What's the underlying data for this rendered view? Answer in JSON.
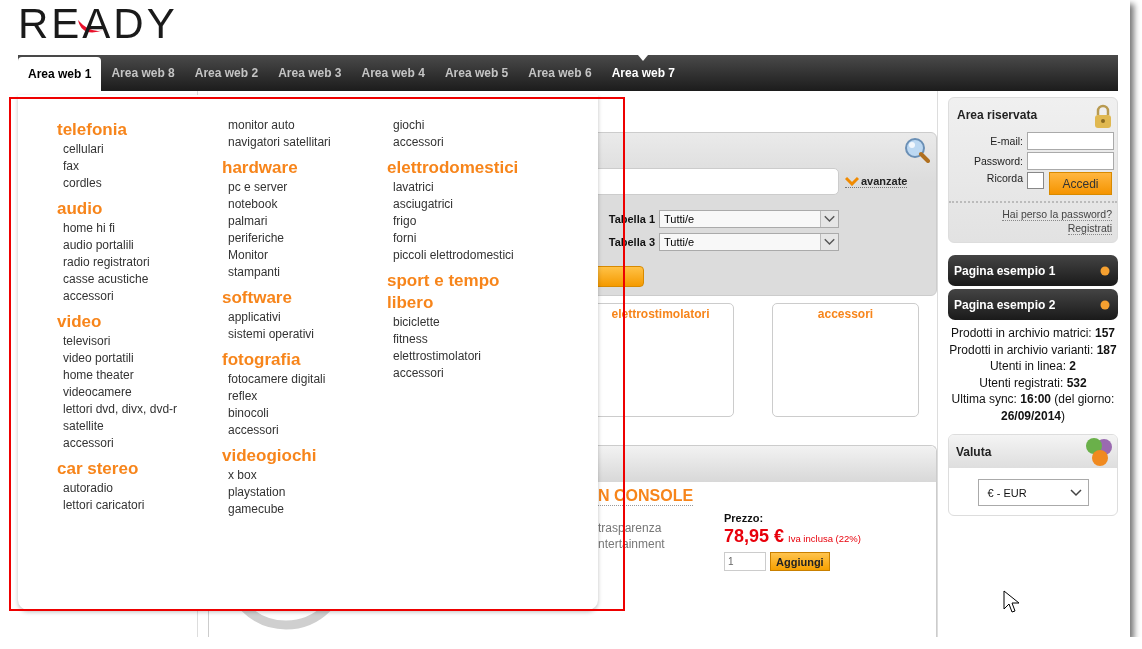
{
  "logo": {
    "text": "READY"
  },
  "nav": {
    "tabs": [
      {
        "label": "Area web 1",
        "selected": true,
        "hovered": false
      },
      {
        "label": "Area web 8",
        "selected": false,
        "hovered": false
      },
      {
        "label": "Area web 2",
        "selected": false,
        "hovered": false
      },
      {
        "label": "Area web 3",
        "selected": false,
        "hovered": false
      },
      {
        "label": "Area web 4",
        "selected": false,
        "hovered": false
      },
      {
        "label": "Area web 5",
        "selected": false,
        "hovered": false
      },
      {
        "label": "Area web 6",
        "selected": false,
        "hovered": false
      },
      {
        "label": "Area web 7",
        "selected": false,
        "hovered": true
      }
    ]
  },
  "menu": {
    "columns": [
      {
        "groups": [
          {
            "heading": "telefonia",
            "items": [
              "cellulari",
              "fax",
              "cordles"
            ]
          },
          {
            "heading": "audio",
            "items": [
              "home hi fi",
              "audio portalili",
              "radio registratori",
              "casse acustiche",
              "accessori"
            ]
          },
          {
            "heading": "video",
            "items": [
              "televisori",
              "video portatili",
              "home theater",
              "videocamere",
              "lettori dvd, divx, dvd-r",
              "satellite",
              "accessori"
            ]
          },
          {
            "heading": "car stereo",
            "items": [
              "autoradio",
              "lettori caricatori"
            ]
          }
        ]
      },
      {
        "groups": [
          {
            "items": [
              "monitor auto",
              "navigatori satellitari"
            ]
          },
          {
            "heading": "hardware",
            "items": [
              "pc e server",
              "notebook",
              "palmari",
              "periferiche",
              "Monitor",
              "stampanti"
            ]
          },
          {
            "heading": "software",
            "items": [
              "applicativi",
              "sistemi operativi"
            ]
          },
          {
            "heading": "fotografia",
            "items": [
              "fotocamere digitali",
              "reflex",
              "binocoli",
              "accessori"
            ]
          },
          {
            "heading": "videogiochi",
            "items": [
              "x box",
              "playstation",
              "gamecube"
            ]
          }
        ]
      },
      {
        "groups": [
          {
            "items": [
              "giochi",
              "accessori"
            ]
          },
          {
            "heading": "elettrodomestici",
            "items": [
              "lavatrici",
              "asciugatrici",
              "frigo",
              "forni",
              "piccoli elettrodomestici"
            ]
          },
          {
            "heading": "sport e tempo libero",
            "items": [
              "biciclette",
              "fitness",
              "elettrostimolatori",
              "accessori"
            ]
          }
        ]
      }
    ]
  },
  "search": {
    "advanced_link": "avanzate",
    "filters": [
      {
        "label": "Tabella 1",
        "value": "Tutti/e"
      },
      {
        "label": "Tabella 3",
        "value": "Tutti/e"
      }
    ]
  },
  "categories": [
    {
      "title": "elettrostimolatori"
    },
    {
      "title": "accessori"
    }
  ],
  "product": {
    "title": "N CONSOLE",
    "description_lines": [
      "trasparenza",
      "ntertainment"
    ],
    "price_label": "Prezzo:",
    "price": "78,95 €",
    "tax_note": "Iva inclusa (22%)",
    "quantity": "1",
    "add_button": "Aggiungi"
  },
  "login": {
    "title": "Area riservata",
    "email_label": "E-mail:",
    "password_label": "Password:",
    "remember_label": "Ricorda",
    "remember": false,
    "submit": "Accedi",
    "links": [
      "Hai perso la password?",
      "Registrati"
    ]
  },
  "pages": [
    {
      "label": "Pagina esempio 1"
    },
    {
      "label": "Pagina esempio 2"
    }
  ],
  "stats": [
    "Prodotti in archivio matrici: **157**",
    "Prodotti in archivio varianti: **187**",
    "Utenti in linea: **2**",
    "Utenti registrati: **532**",
    "Ultima sync: **16:00** (del giorno: **26/09/2014**)"
  ],
  "currency": {
    "title": "Valuta",
    "value": "€ - EUR"
  }
}
